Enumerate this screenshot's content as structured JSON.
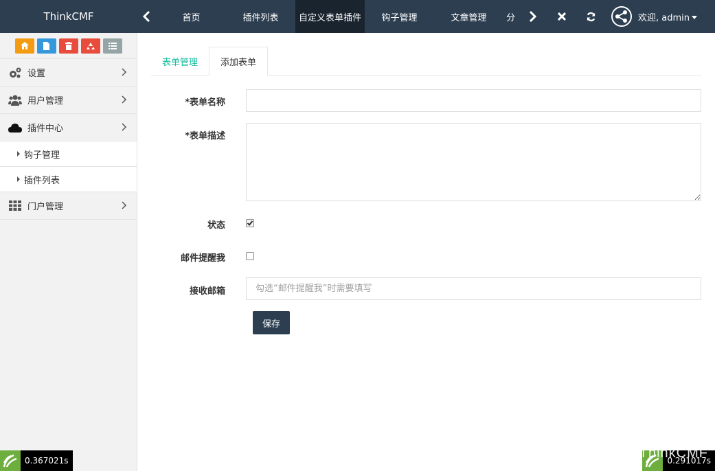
{
  "navbar": {
    "brand": "ThinkCMF",
    "tabs": [
      {
        "label": "首页"
      },
      {
        "label": "插件列表"
      },
      {
        "label": "自定义表单插件"
      },
      {
        "label": "钩子管理"
      },
      {
        "label": "文章管理"
      },
      {
        "label": "分"
      }
    ],
    "user": {
      "label": "欢迎, admin"
    }
  },
  "sidebar": {
    "shortcut_colors": [
      "#f39c12",
      "#3498db",
      "#e74c3c",
      "#e74c3c",
      "#95a5a6"
    ],
    "items": [
      {
        "label": "设置",
        "icon": "gears-icon"
      },
      {
        "label": "用户管理",
        "icon": "users-icon"
      },
      {
        "label": "插件中心",
        "icon": "cloud-icon"
      },
      {
        "label": "门户管理",
        "icon": "th-icon"
      }
    ],
    "subitems": [
      {
        "label": "钩子管理"
      },
      {
        "label": "插件列表"
      }
    ]
  },
  "content": {
    "tabs": [
      {
        "label": "表单管理"
      },
      {
        "label": "添加表单"
      }
    ],
    "form": {
      "name_label": "*表单名称",
      "desc_label": "*表单描述",
      "status_label": "状态",
      "status_checked": true,
      "email_notify_label": "邮件提醒我",
      "email_notify_checked": false,
      "receive_email_label": "接收邮箱",
      "receive_email_placeholder": "勾选“邮件提醒我”时需要填写",
      "save_label": "保存"
    }
  },
  "debug": {
    "left_time": "0.367021s",
    "right_time": "0.291017s",
    "watermark": "ThinkCMF"
  },
  "colors": {
    "navbar": "#2c3e50",
    "active_tab": "#1a242f",
    "accent_link": "#18bc9c",
    "debug_logo": "#6dae3e"
  }
}
